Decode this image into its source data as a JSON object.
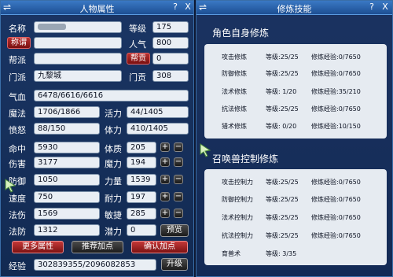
{
  "left_panel": {
    "title": "人物属性",
    "switch_icon": "⇌",
    "help": "?",
    "close": "X",
    "fields": {
      "name_label": "名称",
      "level_label": "等级",
      "level_value": "175",
      "title_label": "称谓",
      "popularity_label": "人气",
      "popularity_value": "800",
      "gang_label": "帮派",
      "gang_contrib_label": "帮贡",
      "gang_contrib_value": "0",
      "sect_label": "门派",
      "sect_value": "九黎城",
      "sect_contrib_label": "门贡",
      "sect_contrib_value": "308",
      "hp_label": "气血",
      "hp_value": "6478/6616/6616",
      "mp_label": "魔法",
      "mp_value": "1706/1866",
      "vitality_label": "活力",
      "vitality_value": "44/1405",
      "anger_label": "愤怒",
      "anger_value": "88/150",
      "stamina_label": "体力",
      "stamina_value": "410/1405"
    },
    "stats": [
      {
        "label": "命中",
        "value": "5930",
        "attr_label": "体质",
        "attr_value": "205",
        "has_pm": true
      },
      {
        "label": "伤害",
        "value": "3177",
        "attr_label": "魔力",
        "attr_value": "194",
        "has_pm": true
      },
      {
        "label": "防御",
        "value": "1050",
        "attr_label": "力量",
        "attr_value": "1539",
        "has_pm": true
      },
      {
        "label": "速度",
        "value": "750",
        "attr_label": "耐力",
        "attr_value": "197",
        "has_pm": true
      },
      {
        "label": "法伤",
        "value": "1569",
        "attr_label": "敏捷",
        "attr_value": "285",
        "has_pm": true
      },
      {
        "label": "法防",
        "value": "1312",
        "attr_label": "潜力",
        "attr_value": "0",
        "has_pm": false
      }
    ],
    "preview_btn": "预览",
    "more_btn": "更多属性",
    "recommend_btn": "推荐加点",
    "confirm_btn": "确认加点",
    "exp_label": "经验",
    "exp_value": "302839355/2096082853",
    "upgrade_btn": "升级",
    "plus": "+",
    "minus": "−"
  },
  "right_panel": {
    "title": "修炼技能",
    "switch_icon": "⇌",
    "help": "?",
    "close": "X",
    "self_header": "角色自身修炼",
    "self_rows": [
      {
        "name": "攻击修炼",
        "level": "等级:25/25",
        "exp": "修炼经验:0/7650"
      },
      {
        "name": "防御修炼",
        "level": "等级:25/25",
        "exp": "修炼经验:0/7650"
      },
      {
        "name": "法术修炼",
        "level": "等级: 1/20",
        "exp": "修炼经验:35/210"
      },
      {
        "name": "抗法修炼",
        "level": "等级:25/25",
        "exp": "修炼经验:0/7650"
      },
      {
        "name": "猎术修炼",
        "level": "等级: 0/20",
        "exp": "修炼经验:10/150"
      }
    ],
    "pet_header": "召唤兽控制修炼",
    "pet_rows": [
      {
        "name": "攻击控制力",
        "level": "等级:25/25",
        "exp": "修炼经验:0/7650"
      },
      {
        "name": "防御控制力",
        "level": "等级:25/25",
        "exp": "修炼经验:0/7650"
      },
      {
        "name": "法术控制力",
        "level": "等级:25/25",
        "exp": "修炼经验:0/7650"
      },
      {
        "name": "抗法控制力",
        "level": "等级:25/25",
        "exp": "修炼经验:0/7650"
      },
      {
        "name": "育兽术",
        "level": "等级: 3/35",
        "exp": ""
      }
    ]
  }
}
